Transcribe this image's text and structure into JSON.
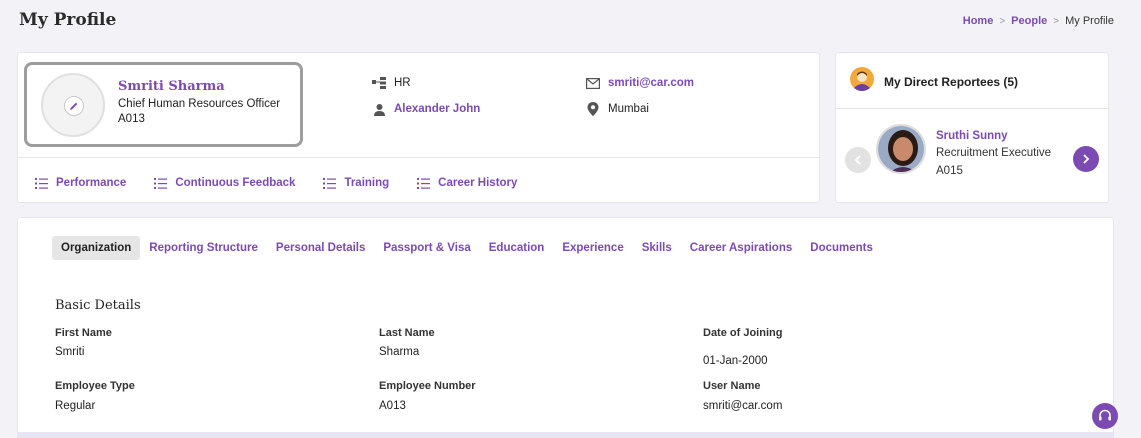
{
  "page": {
    "title": "My Profile"
  },
  "breadcrumb": {
    "items": [
      "Home",
      "People",
      "My Profile"
    ],
    "separator": ">"
  },
  "profile": {
    "name": "Smriti Sharma",
    "role": "Chief Human Resources Officer",
    "employee_id": "A013",
    "department": "HR",
    "manager": "Alexander John",
    "email": "smriti@car.com",
    "location": "Mumbai"
  },
  "quick_links": [
    "Performance",
    "Continuous Feedback",
    "Training",
    "Career History"
  ],
  "reportees": {
    "title": "My Direct Reportees (5)",
    "current": {
      "name": "Sruthi Sunny",
      "role": "Recruitment Executive",
      "id": "A015"
    }
  },
  "tabs": [
    "Organization",
    "Reporting Structure",
    "Personal Details",
    "Passport & Visa",
    "Education",
    "Experience",
    "Skills",
    "Career Aspirations",
    "Documents"
  ],
  "active_tab": "Organization",
  "basic_details": {
    "title": "Basic Details",
    "fields": [
      {
        "label": "First Name",
        "value": "Smriti"
      },
      {
        "label": "Last Name",
        "value": "Sharma"
      },
      {
        "label": "Date of Joining",
        "value": "01-Jan-2000"
      },
      {
        "label": "Employee Type",
        "value": "Regular"
      },
      {
        "label": "Employee Number",
        "value": "A013"
      },
      {
        "label": "User Name",
        "value": "smriti@car.com"
      }
    ]
  },
  "colors": {
    "accent": "#7b4bb3",
    "background": "#f3f3f7",
    "card": "#ffffff"
  },
  "icons": {
    "edit": "pencil-icon",
    "department": "org-chart-icon",
    "manager": "person-icon",
    "email": "envelope-icon",
    "location": "map-pin-icon",
    "quick_link": "list-icon",
    "reportees": "avatar-icon",
    "prev": "chevron-left-icon",
    "next": "chevron-right-icon",
    "help": "headset-icon"
  }
}
